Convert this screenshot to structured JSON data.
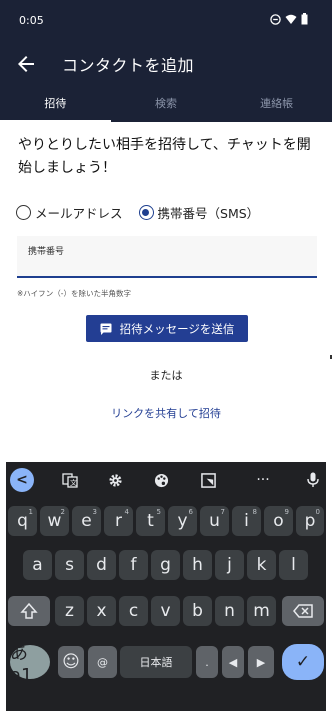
{
  "status_bar": {
    "time": "0:05"
  },
  "app_bar": {
    "title": "コンタクトを追加"
  },
  "tabs": [
    {
      "label": "招待",
      "active": true
    },
    {
      "label": "検索",
      "active": false
    },
    {
      "label": "連絡帳",
      "active": false
    }
  ],
  "intro_text": "やりとりしたい相手を招待して、チャットを開始しましょう！",
  "radio_options": [
    {
      "label": "メールアドレス",
      "selected": false
    },
    {
      "label": "携帯番号（SMS）",
      "selected": true
    }
  ],
  "phone_field": {
    "label": "携帯番号",
    "value": ""
  },
  "hint": "※ハイフン（-）を除いた半角数字",
  "send_button_label": "招待メッセージを送信",
  "or_text": "または",
  "share_link_label": "リンクを共有して招待",
  "keyboard": {
    "toolbar": [
      "<",
      "G",
      "⚙",
      "🎨",
      "◱",
      "···",
      "🎤"
    ],
    "row1": [
      {
        "key": "q",
        "alt": "1"
      },
      {
        "key": "w",
        "alt": "2"
      },
      {
        "key": "e",
        "alt": "3"
      },
      {
        "key": "r",
        "alt": "4"
      },
      {
        "key": "t",
        "alt": "5"
      },
      {
        "key": "y",
        "alt": "6"
      },
      {
        "key": "u",
        "alt": "7"
      },
      {
        "key": "i",
        "alt": "8"
      },
      {
        "key": "o",
        "alt": "9"
      },
      {
        "key": "p",
        "alt": "0"
      }
    ],
    "row2": [
      "a",
      "s",
      "d",
      "f",
      "g",
      "h",
      "j",
      "k",
      "l"
    ],
    "row3": [
      "z",
      "x",
      "c",
      "v",
      "b",
      "n",
      "m"
    ],
    "bottom": {
      "kana": "あa1",
      "emoji": "☺",
      "at": "@",
      "space": "日本語",
      "period": ".",
      "left": "◀",
      "right": "▶",
      "enter": "✓"
    }
  },
  "colors": {
    "header": "#1b2236",
    "accent": "#233e93",
    "keyboard": "#202124"
  }
}
